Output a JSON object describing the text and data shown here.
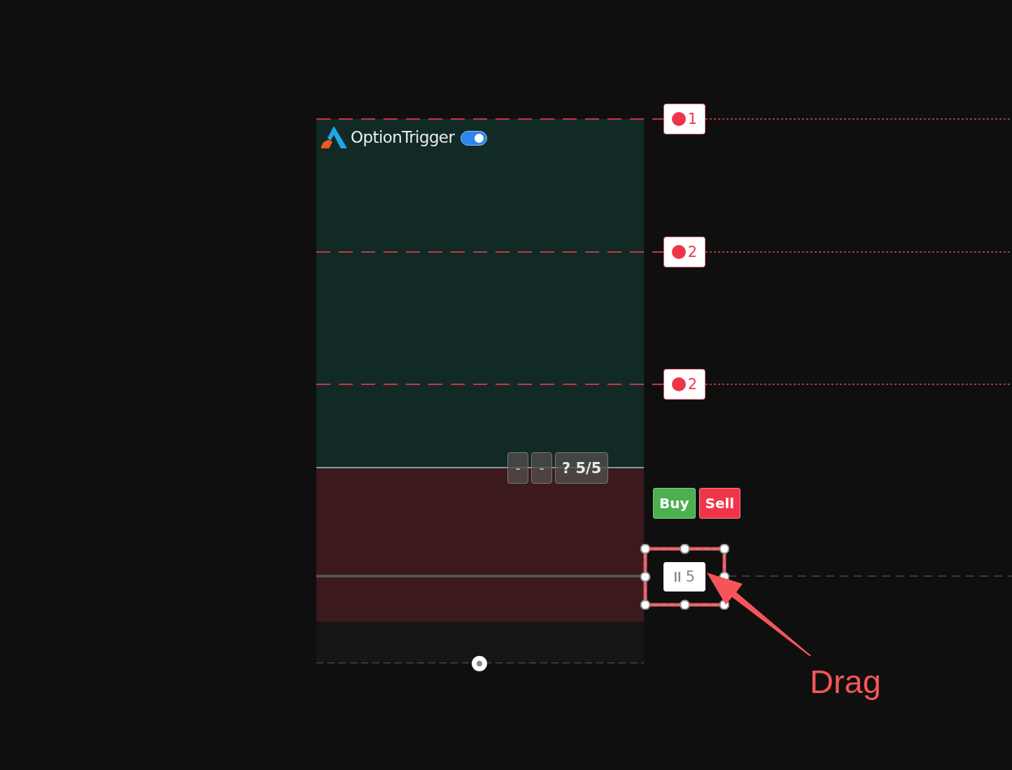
{
  "chart": {
    "brand": {
      "name": "OptionTrigger",
      "enabled": true
    },
    "order_lines": [
      {
        "label": "1"
      },
      {
        "label": "2"
      },
      {
        "label": "2"
      }
    ],
    "controls": [
      {
        "label": "-"
      },
      {
        "label": "-"
      },
      {
        "label": "? 5/5"
      }
    ],
    "trade_buttons": [
      {
        "label": "Buy",
        "kind": "buy"
      },
      {
        "label": "Sell",
        "kind": "sell"
      }
    ],
    "position_line": {
      "label": "5",
      "selected": true
    }
  },
  "annotation": {
    "text": "Drag"
  }
}
